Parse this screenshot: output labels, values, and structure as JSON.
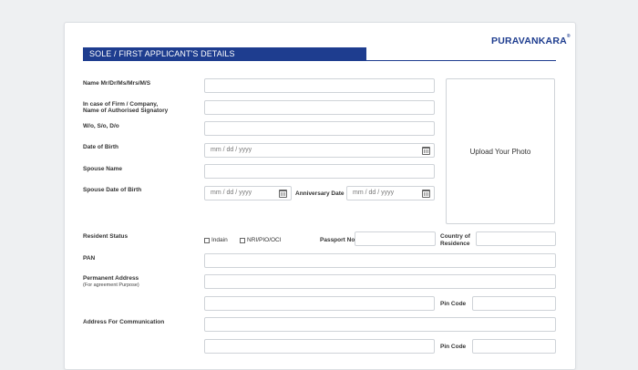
{
  "brand": "PURAVANKARA",
  "section_title": "SOLE / FIRST APPLICANT'S DETAILS",
  "labels": {
    "name": "Name Mr/Dr/Ms/Mrs/M/S",
    "firm_line1": "In case of Firm / Company,",
    "firm_line2": "Name of Authorised Signatory",
    "relation": "W/o, S/o, D/o",
    "dob": "Date of Birth",
    "spouse_name": "Spouse Name",
    "spouse_dob": "Spouse Date of Birth",
    "anniversary": "Anniversary Date",
    "resident_status": "Resident Status",
    "passport": "Passport No",
    "country_line1": "Country of",
    "country_line2": "Residence",
    "pan": "PAN",
    "perm_address": "Permanent Address",
    "perm_address_sub": "(For agreement Purpose)",
    "pin_code": "Pin Code",
    "comm_address": "Address For Communication"
  },
  "placeholders": {
    "date": "mm / dd / yyyy"
  },
  "upload_photo": "Upload Your Photo",
  "resident_options": [
    "Indain",
    "NRI/PIO/OCI"
  ]
}
